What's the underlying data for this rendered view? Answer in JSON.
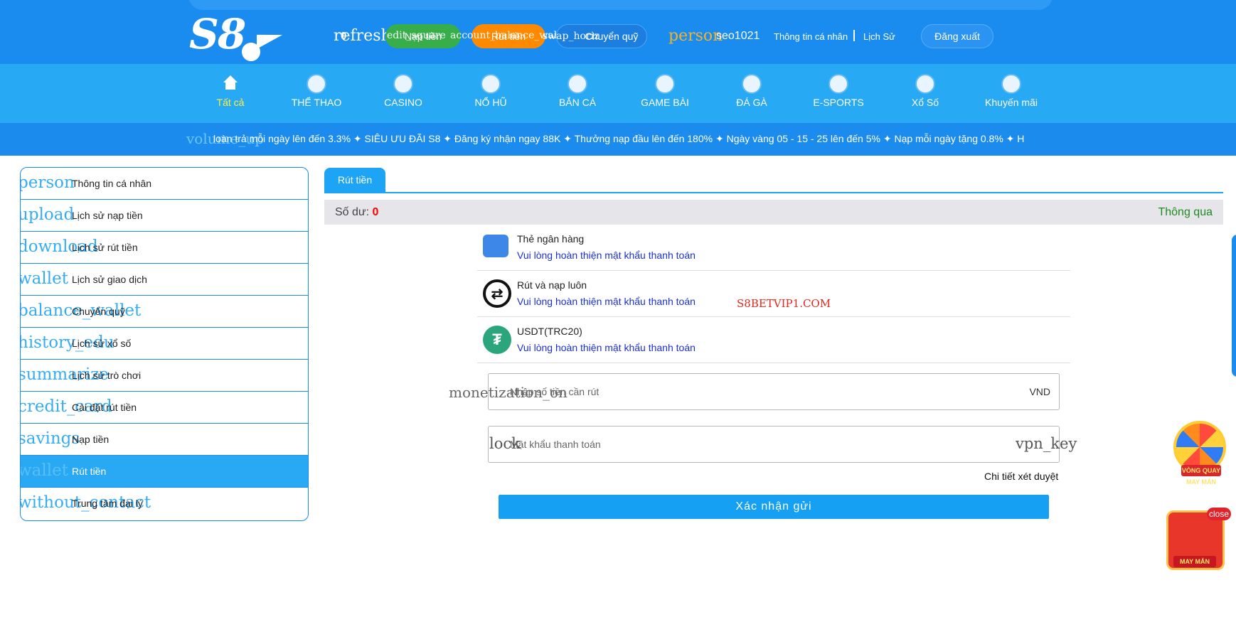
{
  "header": {
    "refresh_icon": "refresh",
    "balance": "0",
    "deposit_overlay": "edit_square",
    "deposit_label": "Nạp tiền",
    "withdraw_overlay": "account_balance_wallet",
    "withdraw_label": "Rút tiền",
    "transfer_overlay": "swap_horiz",
    "transfer_label": "Chuyển quỹ",
    "user_icon": "person",
    "username": "seo1021",
    "profile_link": "Thông tin cá nhân",
    "history_link": "Lịch Sử",
    "logout_label": "Đăng xuất"
  },
  "nav": {
    "items": [
      {
        "label": "Tất cả",
        "icon": "home-icon"
      },
      {
        "label": "THỂ THAO",
        "icon": "soccer-ball-icon"
      },
      {
        "label": "CASINO",
        "icon": "spade-icon"
      },
      {
        "label": "NỔ HŨ",
        "icon": "slot-machine-icon"
      },
      {
        "label": "BẮN CÁ",
        "icon": "fish-icon"
      },
      {
        "label": "GAME BÀI",
        "icon": "chess-pawn-icon"
      },
      {
        "label": "ĐÁ GÀ",
        "icon": "rooster-icon"
      },
      {
        "label": "E-SPORTS",
        "icon": "gamepad-icon"
      },
      {
        "label": "Xổ Số",
        "icon": "lottery-ball-icon"
      },
      {
        "label": "Khuyến mãi",
        "icon": "gift-icon"
      }
    ]
  },
  "marquee": {
    "icon": "volume_up",
    "text": "loàn trả mỗi ngày lên đến 3.3%    ✦ SIÊU ƯU ĐÃI S8 ✦ Đăng ký nhận ngay 88K ✦ Thưởng nạp đầu lên đến 180% ✦ Ngày vàng 05 - 15 - 25 lên đến 5% ✦ Nạp mỗi ngày tặng 0.8% ✦ H"
  },
  "sidebar": {
    "items": [
      {
        "icon": "person",
        "label": "Thông tin cá nhân"
      },
      {
        "icon": "upload",
        "label": "Lịch sử nạp tiền"
      },
      {
        "icon": "download",
        "label": "Lịch sử rút tiền"
      },
      {
        "icon": "wallet",
        "label": "Lịch sử giao dịch"
      },
      {
        "icon": "balance_wallet",
        "label": "Chuyển quỹ"
      },
      {
        "icon": "history_edu",
        "label": "Lịch sử xổ số"
      },
      {
        "icon": "summarize",
        "label": "Lịch sử trò chơi"
      },
      {
        "icon": "credit_card",
        "label": "Cài đặt rút tiền"
      },
      {
        "icon": "savings",
        "label": "Nạp tiền"
      },
      {
        "icon": "wallet",
        "label": "Rút tiền",
        "active": true
      },
      {
        "icon": "without_contact",
        "label": "Trung tâm đại lý"
      }
    ]
  },
  "main": {
    "tab_label": "Rút tiền",
    "balance_label": "Số dư:",
    "balance_value": "0",
    "status": "Thông qua",
    "methods": [
      {
        "name": "Thẻ ngân hàng",
        "hint": "Vui lòng hoàn thiện mật khẩu thanh toán",
        "icon": "bank-card-icon"
      },
      {
        "name": "Rút và nạp luôn",
        "hint": "Vui lòng hoàn thiện mật khẩu thanh toán",
        "icon": "swap-icon"
      },
      {
        "name": "USDT(TRC20)",
        "hint": "Vui lòng hoàn thiện mật khẩu thanh toán",
        "icon": "tether-icon"
      }
    ],
    "watermark": "S8BETVIP1.COM",
    "amount_icon": "monetization_on",
    "amount_placeholder": "Nhập số tiền cần rút",
    "amount_unit": "VND",
    "password_icon": "lock",
    "password_placeholder": "Mật khẩu thanh toán",
    "password_key_icon": "vpn_key",
    "review_link": "Chi tiết xét duyệt",
    "submit_label": "Xác nhận gửi"
  },
  "promos": {
    "wheel_tag": "VÒNG QUAY MAY MẮN",
    "lixi_tag": "MAY MẮN",
    "close_label": "close"
  },
  "colors": {
    "header_bg": "#1a8cf0",
    "nav_bg": "#28a9f4",
    "active_nav_text": "#ffef3b",
    "balance_value": "#ff0000",
    "status_text": "#1f8a1f",
    "hint_text": "#1a2fd6"
  }
}
